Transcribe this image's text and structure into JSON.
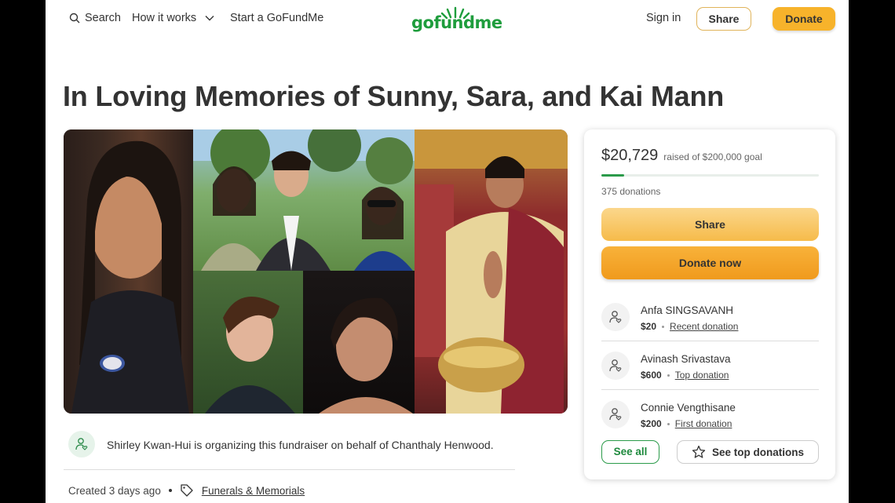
{
  "header": {
    "search_label": "Search",
    "how_it_works_label": "How it works",
    "start_label": "Start a GoFundMe",
    "logo_text": "gofundme",
    "sign_in_label": "Sign in",
    "share_label": "Share",
    "donate_label": "Donate"
  },
  "campaign": {
    "title": "In Loving Memories of Sunny, Sara, and Kai Mann",
    "raised_amount": "$20,729",
    "goal_text": "raised of $200,000 goal",
    "progress_fraction": 0.104,
    "donations_count": "375 donations",
    "share_label": "Share",
    "donate_now_label": "Donate now",
    "see_all_label": "See all",
    "see_top_label": "See top donations"
  },
  "donors": [
    {
      "name": "Anfa SINGSAVANH",
      "amount": "$20",
      "tag": "Recent donation"
    },
    {
      "name": "Avinash Srivastava",
      "amount": "$600",
      "tag": "Top donation"
    },
    {
      "name": "Connie Vengthisane",
      "amount": "$200",
      "tag": "First donation"
    }
  ],
  "organizer": {
    "text": "Shirley Kwan-Hui is organizing this fundraiser on behalf of Chanthaly Henwood."
  },
  "meta": {
    "created": "Created 3 days ago",
    "category": "Funerals & Memorials"
  },
  "colors": {
    "brand_green": "#1f9d3d",
    "donate_orange": "#f7b32b",
    "progress_green": "#2b9b4a"
  },
  "icons": [
    "search-icon",
    "chevron-down-icon",
    "user-heart-icon",
    "star-icon",
    "tag-icon"
  ]
}
